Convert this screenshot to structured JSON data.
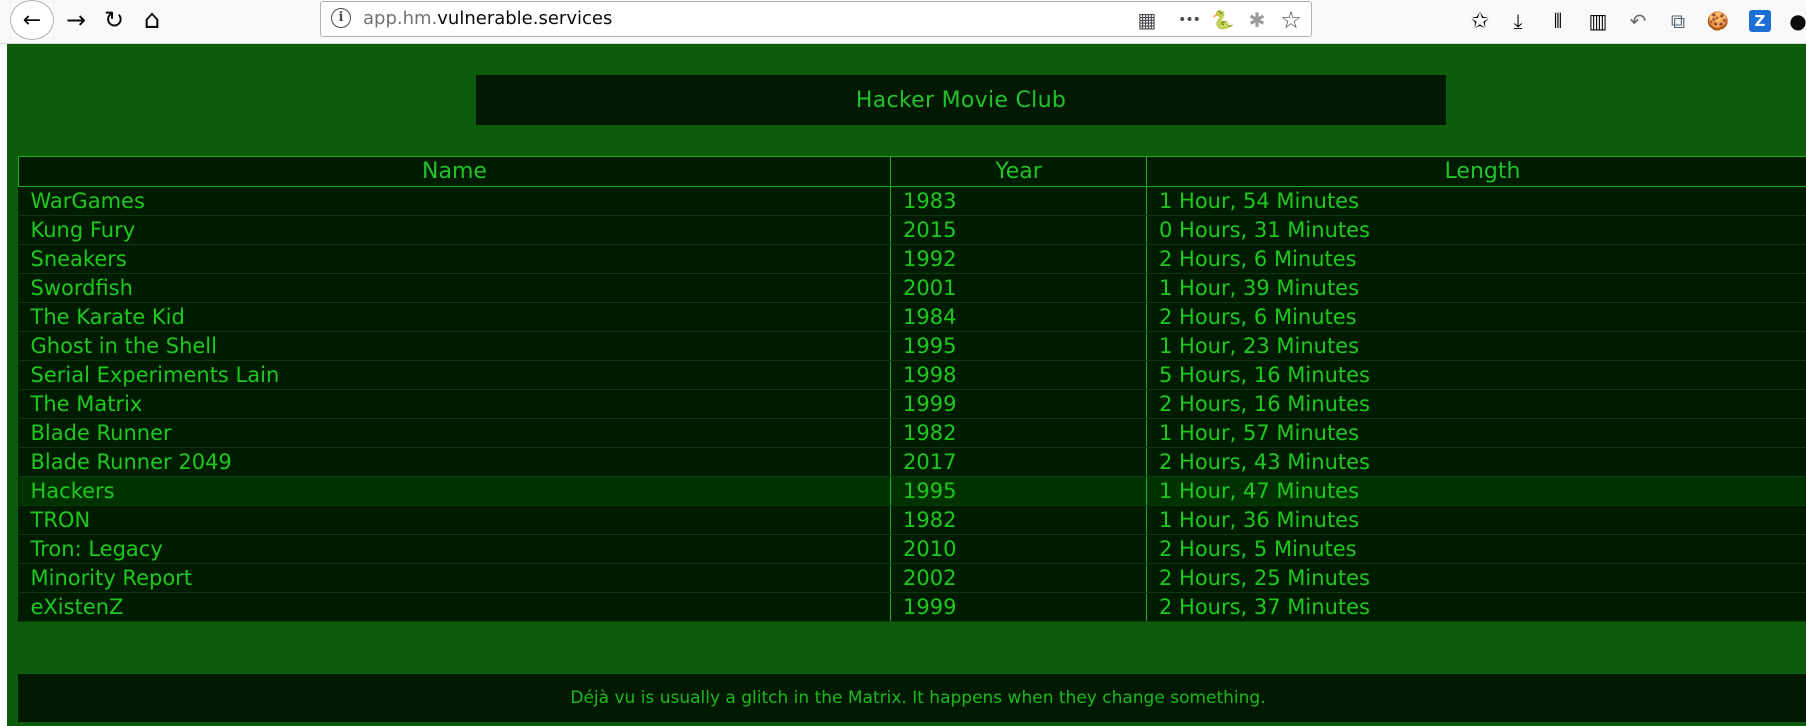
{
  "browser": {
    "url_prefix": "app.hm.",
    "url_domain": "vulnerable.services",
    "icons": {
      "back": "←",
      "forward": "→",
      "reload": "↻",
      "home": "⌂",
      "info": "i",
      "qr": "▦",
      "more": "•••",
      "python": "🐍",
      "bug": "✱",
      "star": "☆",
      "bookmark_star": "✩",
      "download": "⤓",
      "library": "⫴",
      "sidebar": "▥",
      "undo": "↶",
      "crop": "⧉",
      "cookie": "🍪",
      "extension": "Z",
      "account": "●"
    }
  },
  "page": {
    "title": "Hacker Movie Club",
    "columns": [
      "Name",
      "Year",
      "Length"
    ],
    "movies": [
      {
        "name": "WarGames",
        "year": "1983",
        "length": "1 Hour, 54 Minutes"
      },
      {
        "name": "Kung Fury",
        "year": "2015",
        "length": "0 Hours, 31 Minutes"
      },
      {
        "name": "Sneakers",
        "year": "1992",
        "length": "2 Hours, 6 Minutes"
      },
      {
        "name": "Swordfish",
        "year": "2001",
        "length": "1 Hour, 39 Minutes"
      },
      {
        "name": "The Karate Kid",
        "year": "1984",
        "length": "2 Hours, 6 Minutes"
      },
      {
        "name": "Ghost in the Shell",
        "year": "1995",
        "length": "1 Hour, 23 Minutes"
      },
      {
        "name": "Serial Experiments Lain",
        "year": "1998",
        "length": "5 Hours, 16 Minutes"
      },
      {
        "name": "The Matrix",
        "year": "1999",
        "length": "2 Hours, 16 Minutes"
      },
      {
        "name": "Blade Runner",
        "year": "1982",
        "length": "1 Hour, 57 Minutes"
      },
      {
        "name": "Blade Runner 2049",
        "year": "2017",
        "length": "2 Hours, 43 Minutes"
      },
      {
        "name": "Hackers",
        "year": "1995",
        "length": "1 Hour, 47 Minutes"
      },
      {
        "name": "TRON",
        "year": "1982",
        "length": "1 Hour, 36 Minutes"
      },
      {
        "name": "Tron: Legacy",
        "year": "2010",
        "length": "2 Hours, 5 Minutes"
      },
      {
        "name": "Minority Report",
        "year": "2002",
        "length": "2 Hours, 25 Minutes"
      },
      {
        "name": "eXistenZ",
        "year": "1999",
        "length": "2 Hours, 37 Minutes"
      }
    ],
    "highlighted_row": 10,
    "footer": "Déjà vu is usually a glitch in the Matrix. It happens when they change something."
  },
  "colors": {
    "page_bg": "#0b5c0b",
    "panel_bg": "#001900",
    "text_green": "#22c22a",
    "highlight_row": "#003200"
  }
}
